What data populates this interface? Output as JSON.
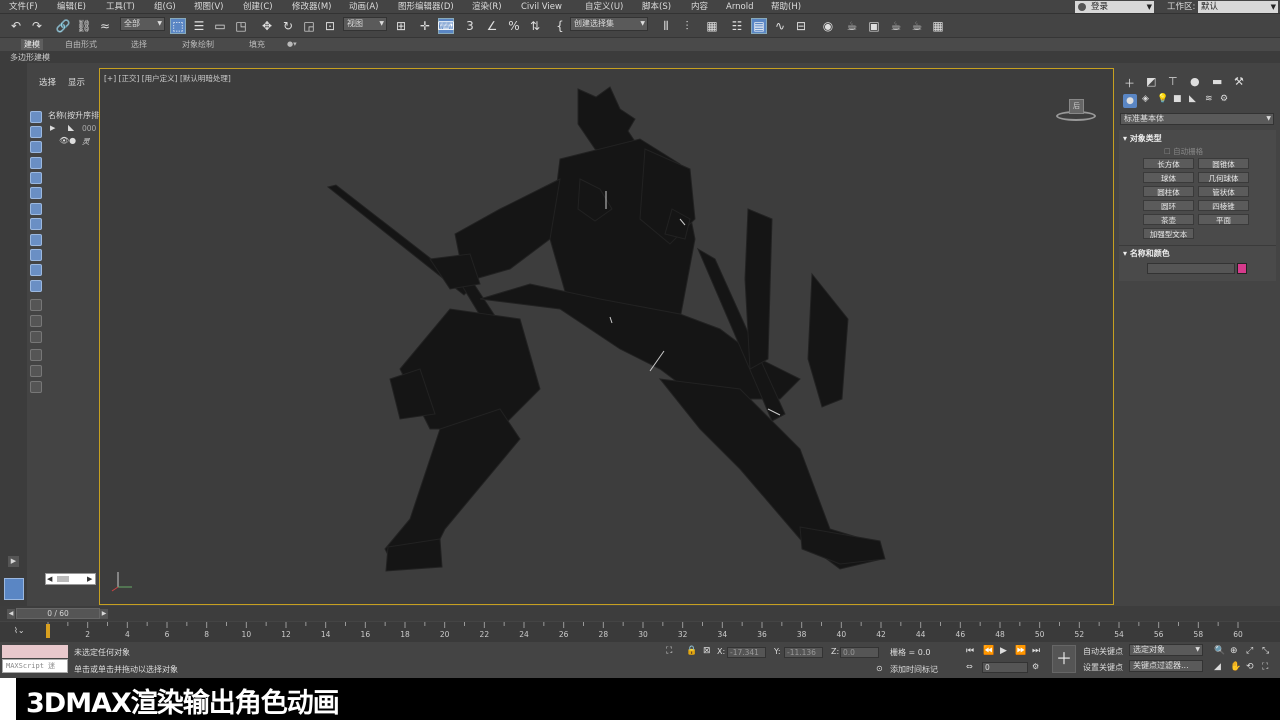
{
  "menubar": {
    "items": [
      "文件(F)",
      "编辑(E)",
      "工具(T)",
      "组(G)",
      "视图(V)",
      "创建(C)",
      "修改器(M)",
      "动画(A)",
      "图形编辑器(D)",
      "渲染(R)",
      "Civil View",
      "自定义(U)",
      "脚本(S)",
      "内容",
      "Arnold",
      "帮助(H)"
    ],
    "login": "登录",
    "workspace_label": "工作区:",
    "workspace_value": "默认"
  },
  "toolbar": {
    "filter_select": "全部",
    "view_select": "视图",
    "selection_set": "创建选择集"
  },
  "ribbon": {
    "tabs": [
      "建模",
      "自由形式",
      "选择",
      "对象绘制",
      "填充"
    ],
    "subtitle": "多边形建模"
  },
  "scene_explorer": {
    "tab_select": "选择",
    "tab_display": "显示",
    "name_header": "名称(按升序排",
    "row1": "000",
    "row2": "灵"
  },
  "viewport": {
    "label": "[+] [正交] [用户定义] [默认明暗处理]",
    "viewcube": "后"
  },
  "command_panel": {
    "category_select": "标准基本体",
    "rollout_object_type": "对象类型",
    "autogrid": "自动栅格",
    "buttons": [
      "长方体",
      "圆锥体",
      "球体",
      "几何球体",
      "圆柱体",
      "管状体",
      "圆环",
      "四棱锥",
      "茶壶",
      "平面",
      "加强型文本"
    ],
    "rollout_name_color": "名称和颜色",
    "color": "#d63a8c"
  },
  "timeline": {
    "frame_display": "0 / 60",
    "ticks": [
      "0",
      "2",
      "4",
      "6",
      "8",
      "10",
      "12",
      "14",
      "16",
      "18",
      "20",
      "22",
      "24",
      "26",
      "28",
      "30",
      "32",
      "34",
      "36",
      "38",
      "40",
      "42",
      "44",
      "46",
      "48",
      "50",
      "52",
      "54",
      "56",
      "58",
      "60"
    ]
  },
  "status": {
    "maxscript": "MAXScript 迷",
    "line1": "未选定任何对象",
    "line2": "单击或单击并拖动以选择对象",
    "x_label": "X:",
    "x_value": "-17.341",
    "y_label": "Y:",
    "y_value": "-11.136",
    "z_label": "Z:",
    "z_value": "0.0",
    "grid": "栅格 = 0.0",
    "add_time_tag": "添加时间标记",
    "auto_key": "自动关键点",
    "set_key": "设置关键点",
    "selected_object": "选定对象",
    "key_filters": "关键点过滤器...",
    "frame_field": "0"
  },
  "caption": {
    "text": "3DMAX渲染输出角色动画"
  }
}
